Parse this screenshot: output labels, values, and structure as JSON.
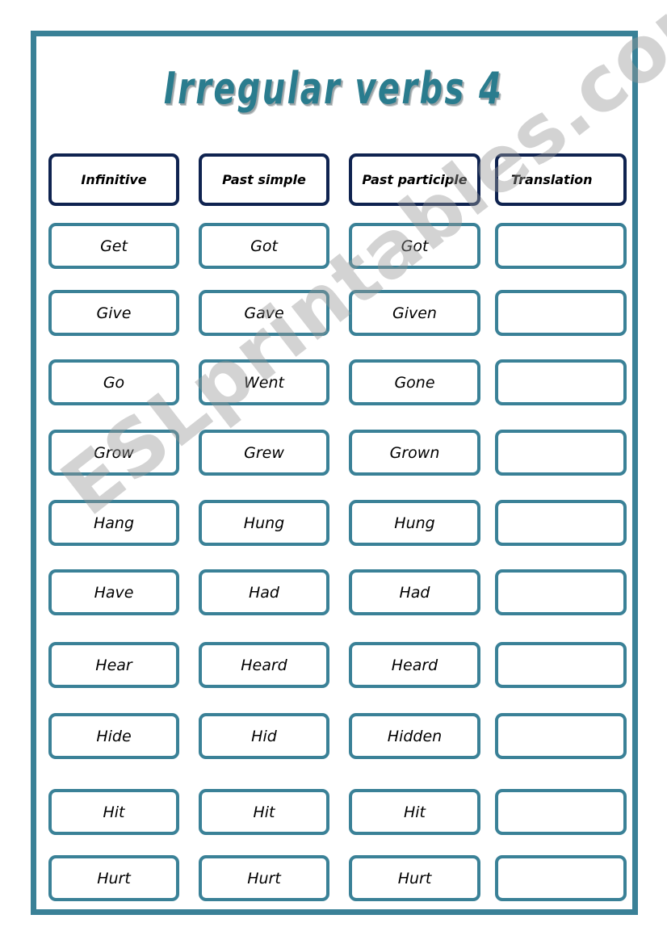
{
  "worksheet": {
    "title": "Irregular verbs 4",
    "colors": {
      "frame": "#3a8197",
      "header_border": "#0f2350",
      "title": "#2a7c8e"
    },
    "columns": [
      "Infinitive",
      "Past simple",
      "Past participle",
      "Translation"
    ],
    "rows": [
      {
        "infinitive": "Get",
        "past_simple": "Got",
        "past_participle": "Got",
        "translation": ""
      },
      {
        "infinitive": "Give",
        "past_simple": "Gave",
        "past_participle": "Given",
        "translation": ""
      },
      {
        "infinitive": "Go",
        "past_simple": "Went",
        "past_participle": "Gone",
        "translation": ""
      },
      {
        "infinitive": "Grow",
        "past_simple": "Grew",
        "past_participle": "Grown",
        "translation": ""
      },
      {
        "infinitive": "Hang",
        "past_simple": "Hung",
        "past_participle": "Hung",
        "translation": ""
      },
      {
        "infinitive": "Have",
        "past_simple": "Had",
        "past_participle": "Had",
        "translation": ""
      },
      {
        "infinitive": "Hear",
        "past_simple": "Heard",
        "past_participle": "Heard",
        "translation": ""
      },
      {
        "infinitive": "Hide",
        "past_simple": "Hid",
        "past_participle": "Hidden",
        "translation": ""
      },
      {
        "infinitive": "Hit",
        "past_simple": "Hit",
        "past_participle": "Hit",
        "translation": ""
      },
      {
        "infinitive": "Hurt",
        "past_simple": "Hurt",
        "past_participle": "Hurt",
        "translation": ""
      }
    ],
    "watermark": "ESLprintables.com"
  }
}
